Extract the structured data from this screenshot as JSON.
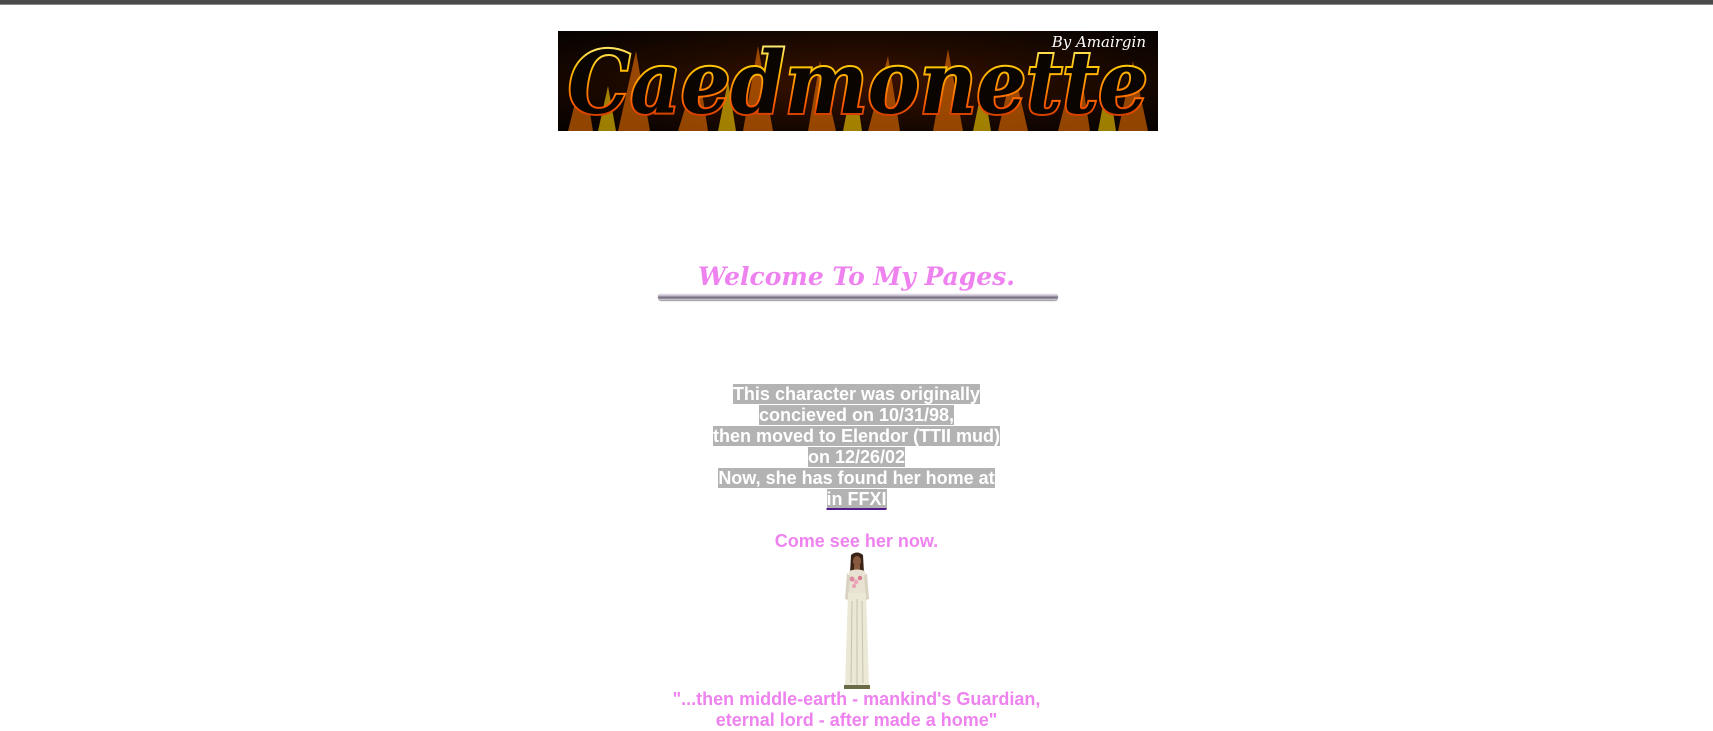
{
  "banner": {
    "title": "Caedmonette",
    "signature": "By Amairgin"
  },
  "welcome": "Welcome To My Pages.",
  "info": {
    "lines": [
      "This character was originally",
      "concieved on 10/31/98,",
      "then moved to Elendor (TTII mud)",
      "on 12/26/02",
      "Now, she has found her home at"
    ],
    "link_text": "in FFXI"
  },
  "come_see": "Come see her now.",
  "quote": [
    "\"...then middle-earth - mankind's Guardian,",
    "eternal lord - after made a home\""
  ],
  "colors": {
    "accent": "#ee82ee",
    "highlight": "#b3b3b3",
    "link_underline": "#551a8b"
  }
}
